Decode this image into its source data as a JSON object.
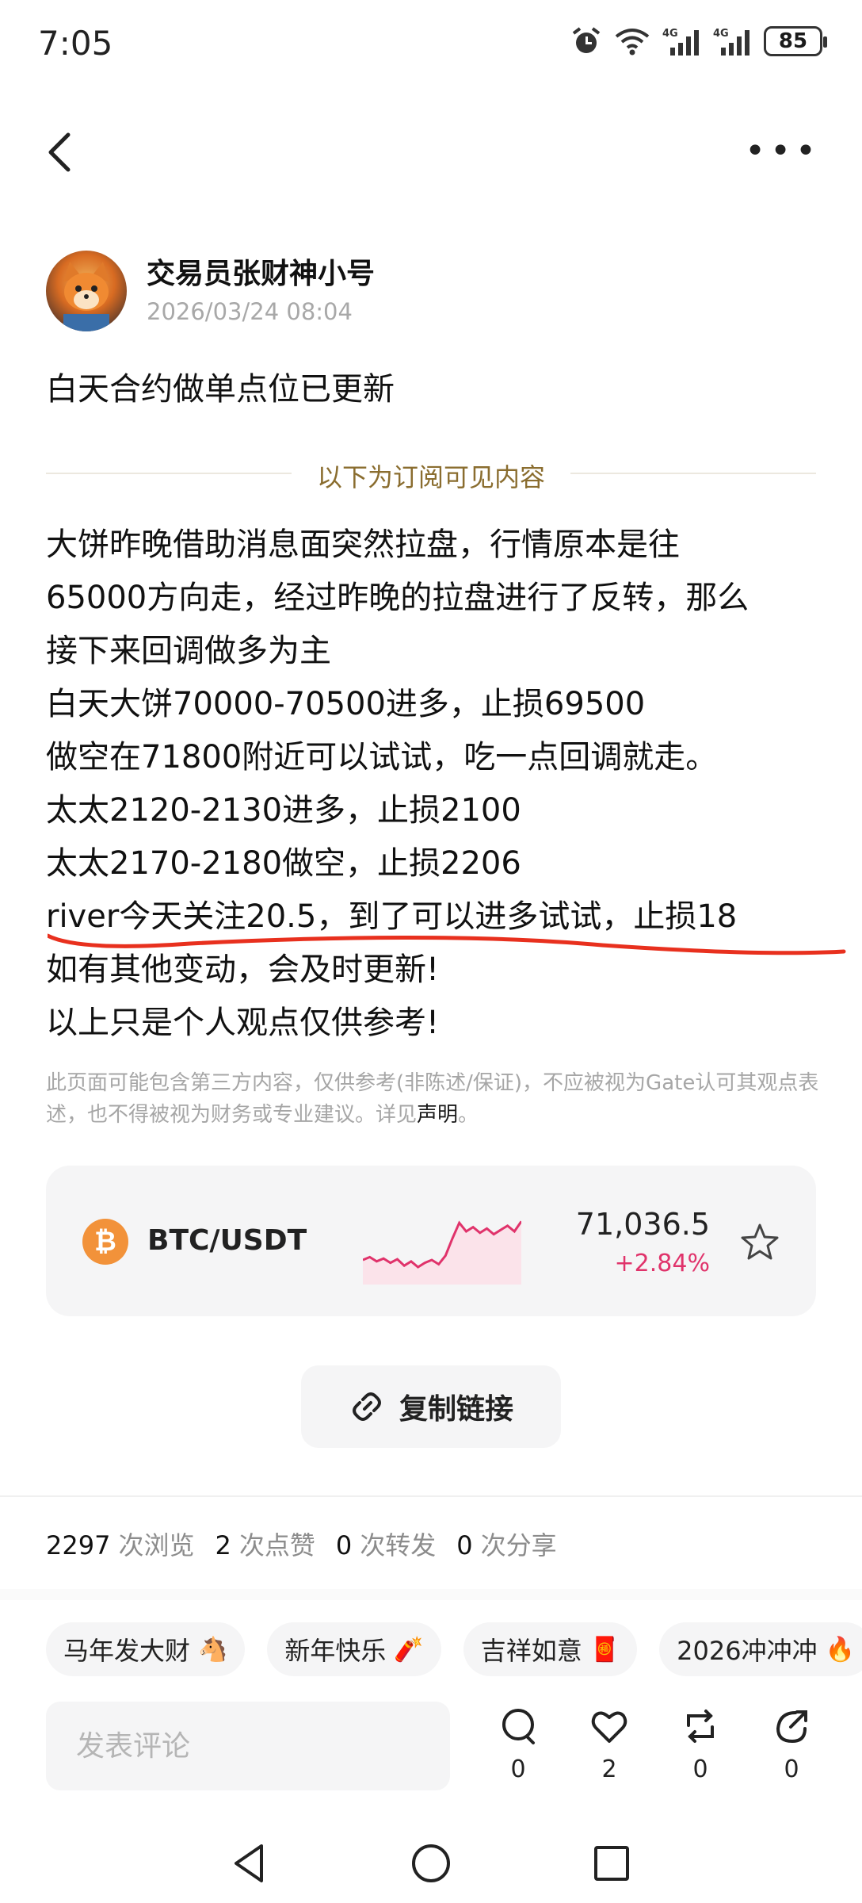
{
  "status_bar": {
    "time": "7:05",
    "battery": "85"
  },
  "post": {
    "author": "交易员张财神小号",
    "timestamp": "2026/03/24 08:04",
    "title": "白天合约做单点位已更新",
    "subscriber_divider": "以下为订阅可见内容",
    "body_lines": [
      "大饼昨晚借助消息面突然拉盘，行情原本是往",
      "65000方向走，经过昨晚的拉盘进行了反转，那么",
      "接下来回调做多为主",
      "白天大饼70000-70500进多，止损69500",
      "做空在71800附近可以试试，吃一点回调就走。",
      "太太2120-2130进多，止损2100",
      "太太2170-2180做空，止损2206",
      "river今天关注20.5，到了可以进多试试，止损18",
      "如有其他变动，会及时更新!",
      "以上只是个人观点仅供参考!"
    ],
    "disclaimer_text": "此页面可能包含第三方内容，仅供参考(非陈述/保证)，不应被视为Gate认可其观点表述，也不得被视为财务或专业建议。详见",
    "disclaimer_link": "声明",
    "disclaimer_end": "。"
  },
  "ticker": {
    "icon_glyph": "₿",
    "pair": "BTC/USDT",
    "price": "71,036.5",
    "change": "+2.84%",
    "change_color": "#e0336b",
    "sparkline": [
      0.3,
      0.34,
      0.28,
      0.32,
      0.26,
      0.31,
      0.22,
      0.28,
      0.2,
      0.26,
      0.3,
      0.24,
      0.36,
      0.6,
      0.82,
      0.7,
      0.76,
      0.68,
      0.74,
      0.66,
      0.72,
      0.78,
      0.7,
      0.84
    ]
  },
  "copy_link": {
    "label": "复制链接"
  },
  "stats": [
    {
      "num": "2297",
      "label": "次浏览"
    },
    {
      "num": "2",
      "label": "次点赞"
    },
    {
      "num": "0",
      "label": "次转发"
    },
    {
      "num": "0",
      "label": "次分享"
    }
  ],
  "tags": [
    {
      "label": "马年发大财",
      "emoji": "🐴"
    },
    {
      "label": "新年快乐",
      "emoji": "🧨"
    },
    {
      "label": "吉祥如意",
      "emoji": "🧧"
    },
    {
      "label": "2026冲冲冲",
      "emoji": "🔥"
    }
  ],
  "comment": {
    "placeholder": "发表评论"
  },
  "actions": [
    {
      "name": "comment",
      "count": "0"
    },
    {
      "name": "like",
      "count": "2"
    },
    {
      "name": "repost",
      "count": "0"
    },
    {
      "name": "share",
      "count": "0"
    }
  ]
}
